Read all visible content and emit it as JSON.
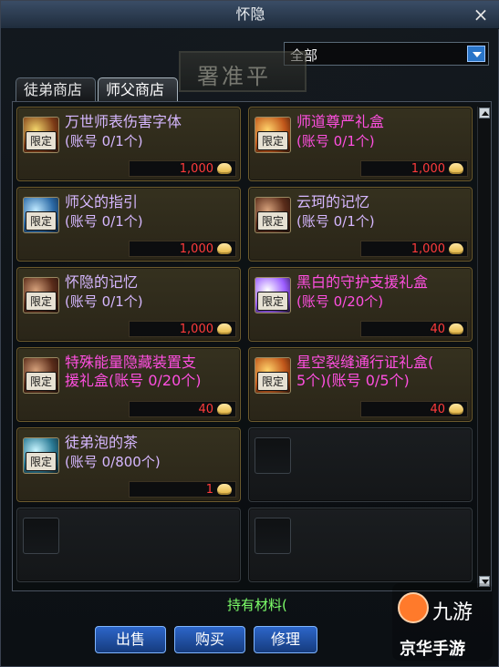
{
  "window": {
    "title": "怀隐"
  },
  "filter": {
    "selected": "全部"
  },
  "tabs": [
    {
      "label": "徒弟商店"
    },
    {
      "label": "师父商店"
    }
  ],
  "items": [
    {
      "name": "万世师表伤害字体",
      "sub": "(账号 0/1个)",
      "price": "1,000",
      "badge": "限定"
    },
    {
      "name": "师道尊严礼盒",
      "sub": "(账号 0/1个)",
      "price": "1,000",
      "badge": "限定"
    },
    {
      "name": "师父的指引",
      "sub": "(账号 0/1个)",
      "price": "1,000",
      "badge": "限定"
    },
    {
      "name": "云珂的记忆",
      "sub": "(账号 0/1个)",
      "price": "1,000",
      "badge": "限定"
    },
    {
      "name": "怀隐的记忆",
      "sub": "(账号 0/1个)",
      "price": "1,000",
      "badge": "限定"
    },
    {
      "name": "黑白的守护支援礼盒",
      "sub": "(账号 0/20个)",
      "price": "40",
      "badge": "限定"
    },
    {
      "name": "特殊能量隐藏装置支\n援礼盒(账号 0/20个)",
      "sub": "",
      "price": "40",
      "badge": "限定"
    },
    {
      "name": "星空裂缝通行证礼盒(\n5个)(账号 0/5个)",
      "sub": "",
      "price": "40",
      "badge": "限定"
    },
    {
      "name": "徒弟泡的茶",
      "sub": "(账号 0/800个)",
      "price": "1",
      "badge": "限定"
    }
  ],
  "footer": {
    "holding_text": "持有材料(",
    "buttons": [
      "出售",
      "购买",
      "修理"
    ]
  },
  "watermark": {
    "line1": "九游",
    "line2": "京华手游"
  }
}
